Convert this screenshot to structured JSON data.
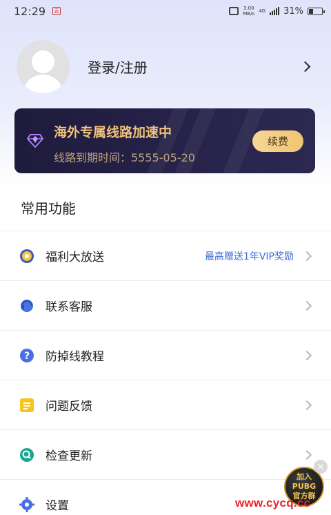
{
  "status_bar": {
    "time": "12:29",
    "app_icon_text": "云",
    "net_speed_top": "3.00",
    "net_speed_bottom": "MB/s",
    "signal_label": "4G",
    "battery_text": "31%"
  },
  "profile": {
    "login_label": "登录/注册"
  },
  "vip_card": {
    "title": "海外专属线路加速中",
    "expire_text": "线路到期时间：5555-05-20",
    "renew_label": "续费",
    "accent_color": "#f1c27b"
  },
  "section_title": "常用功能",
  "menu": [
    {
      "label": "福利大放送",
      "extra": "最高赠送1年VIP奖励",
      "icon": "gift-badge-icon"
    },
    {
      "label": "联系客服",
      "extra": "",
      "icon": "customer-service-icon"
    },
    {
      "label": "防掉线教程",
      "extra": "",
      "icon": "question-icon"
    },
    {
      "label": "问题反馈",
      "extra": "",
      "icon": "feedback-icon"
    },
    {
      "label": "检查更新",
      "extra": "",
      "icon": "search-update-icon"
    },
    {
      "label": "设置",
      "extra": "",
      "icon": "gear-icon"
    }
  ],
  "float_badge": {
    "line1": "加入",
    "line2": "PUBG",
    "line3": "官方群",
    "close": "×"
  },
  "watermark": "www.cycq.cc"
}
